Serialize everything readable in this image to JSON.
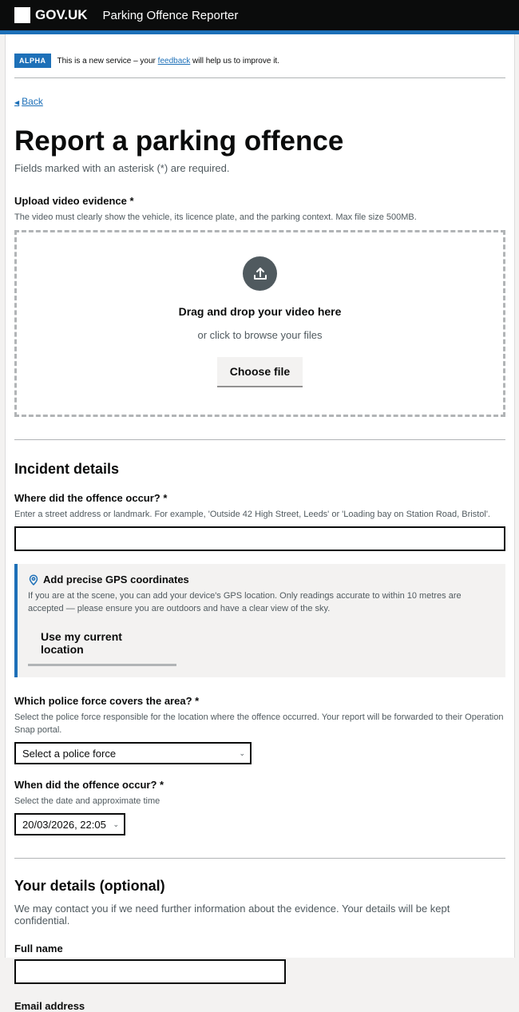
{
  "header": {
    "logo_text": "GOV.UK",
    "service_name": "Parking Offence Reporter"
  },
  "phase_banner": {
    "tag": "ALPHA",
    "text_before": "This is a new service – your ",
    "link": "feedback",
    "text_after": " will help us to improve it."
  },
  "back_link": "Back",
  "page": {
    "title": "Report a parking offence",
    "required_note": "Fields marked with an asterisk (*) are required."
  },
  "upload": {
    "label": "Upload video evidence *",
    "hint": "The video must clearly show the vehicle, its licence plate, and the parking context. Max file size 500MB.",
    "drop_title": "Drag and drop your video here",
    "drop_sub": "or click to browse your files",
    "button": "Choose file"
  },
  "incident": {
    "heading": "Incident details",
    "location_label": "Where did the offence occur? *",
    "location_hint": "Enter a street address or landmark. For example, 'Outside 42 High Street, Leeds' or 'Loading bay on Station Road, Bristol'.",
    "location_value": "",
    "gps": {
      "title": "Add precise GPS coordinates",
      "text": "If you are at the scene, you can add your device's GPS location. Only readings accurate to within 10 metres are accepted — please ensure you are outdoors and have a clear view of the sky.",
      "button": "Use my current location"
    },
    "police_label": "Which police force covers the area? *",
    "police_hint": "Select the police force responsible for the location where the offence occurred. Your report will be forwarded to their Operation Snap portal.",
    "police_selected": "Select a police force",
    "when_label": "When did the offence occur? *",
    "when_hint": "Select the date and approximate time",
    "when_value": "20/03/2026, 22:05"
  },
  "your_details": {
    "heading": "Your details (optional)",
    "hint": "We may contact you if we need further information about the evidence. Your details will be kept confidential.",
    "full_name_label": "Full name",
    "full_name_value": "",
    "email_label": "Email address"
  },
  "colors": {
    "brand_blue": "#1d70b8",
    "header_black": "#0b0c0c"
  }
}
